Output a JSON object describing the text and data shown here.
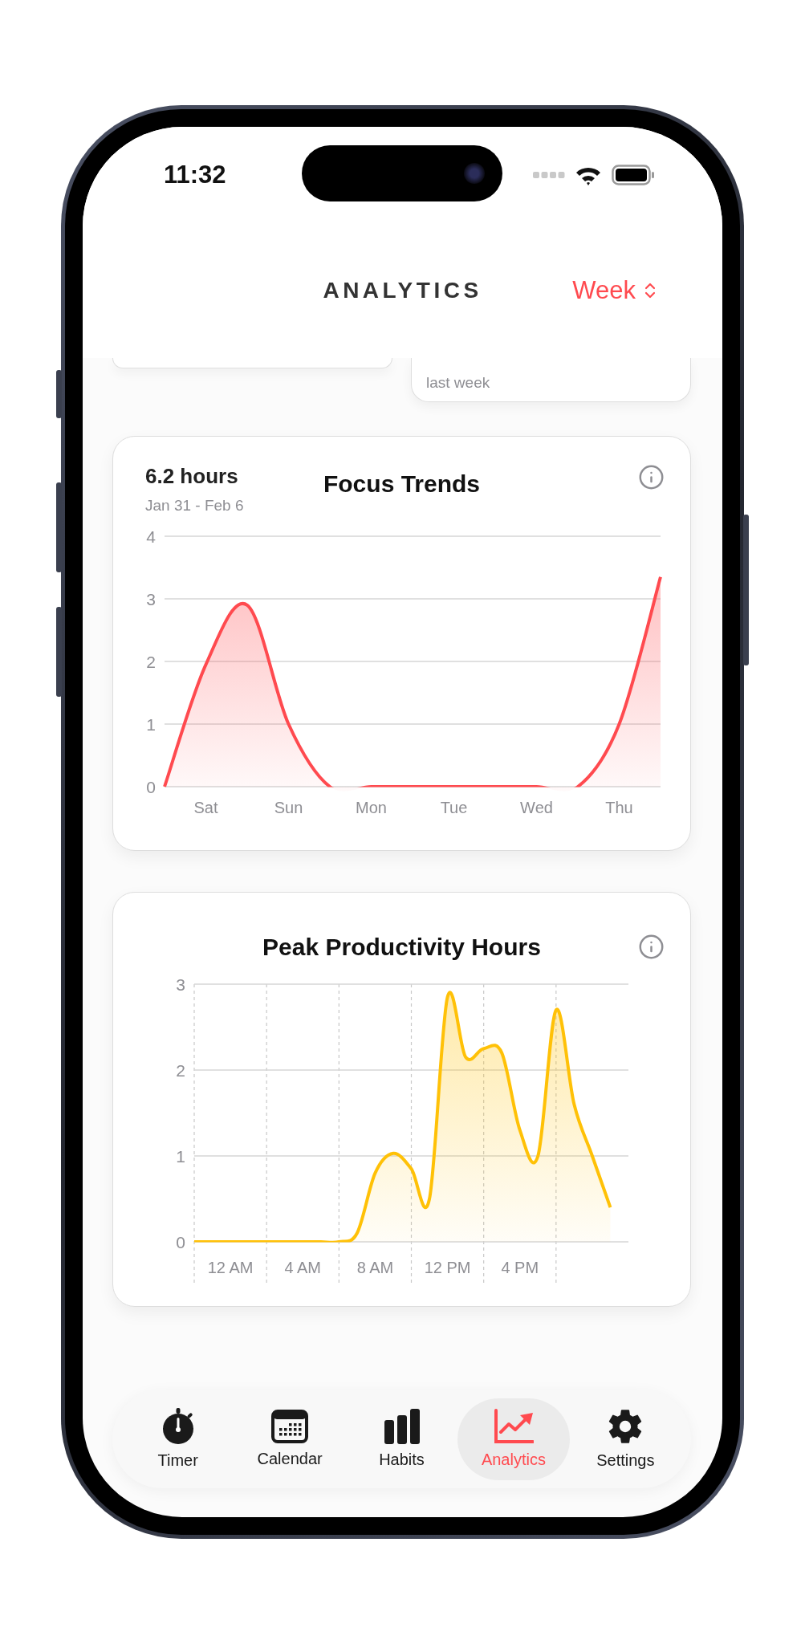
{
  "status_bar": {
    "time": "11:32"
  },
  "header": {
    "title": "ANALYTICS",
    "period": "Week"
  },
  "summary_cards": [
    {
      "kind": "blank"
    },
    {
      "kind": "caption",
      "caption": "last week"
    }
  ],
  "focus_trends": {
    "total": "6.2 hours",
    "range": "Jan 31 - Feb 6",
    "chart_data": {
      "type": "area",
      "title": "Focus Trends",
      "categories": [
        null,
        "Sat",
        null,
        "Sun",
        null,
        "Mon",
        null,
        "Tue",
        null,
        "Wed",
        null,
        "Thu",
        null
      ],
      "series": [
        {
          "color": "#ff4a4f",
          "values": [
            0,
            1.95,
            2.9,
            1.0,
            0,
            0,
            0,
            0,
            0,
            0,
            0,
            1.0,
            3.35
          ]
        }
      ],
      "ylim": [
        0,
        4
      ],
      "yticks": [
        0,
        1,
        2,
        3,
        4
      ],
      "grid": true
    }
  },
  "peak_hours": {
    "chart_data": {
      "type": "area",
      "title": "Peak Productivity Hours",
      "categories": [
        null,
        null,
        "12 AM",
        null,
        null,
        null,
        "4 AM",
        null,
        null,
        null,
        "8 AM",
        null,
        null,
        null,
        "12 PM",
        null,
        null,
        null,
        "4 PM",
        null,
        null,
        null,
        null,
        null,
        null
      ],
      "series": [
        {
          "color": "#ffc107",
          "values": [
            0,
            0,
            0,
            0,
            0,
            0,
            0,
            0,
            0,
            0.1,
            0.8,
            1.03,
            0.85,
            0.5,
            2.85,
            2.15,
            2.25,
            2.2,
            1.3,
            1.0,
            2.7,
            1.6,
            1.0,
            0.4,
            null
          ]
        }
      ],
      "ylim": [
        0,
        3
      ],
      "yticks": [
        0,
        1,
        2,
        3
      ],
      "grid": true
    }
  },
  "tab_bar": [
    {
      "kind": "timer",
      "label": "Timer",
      "selected": false
    },
    {
      "kind": "calendar",
      "label": "Calendar",
      "selected": false
    },
    {
      "kind": "habits",
      "label": "Habits",
      "selected": false
    },
    {
      "kind": "analytics",
      "label": "Analytics",
      "selected": true
    },
    {
      "kind": "settings",
      "label": "Settings",
      "selected": false
    }
  ]
}
